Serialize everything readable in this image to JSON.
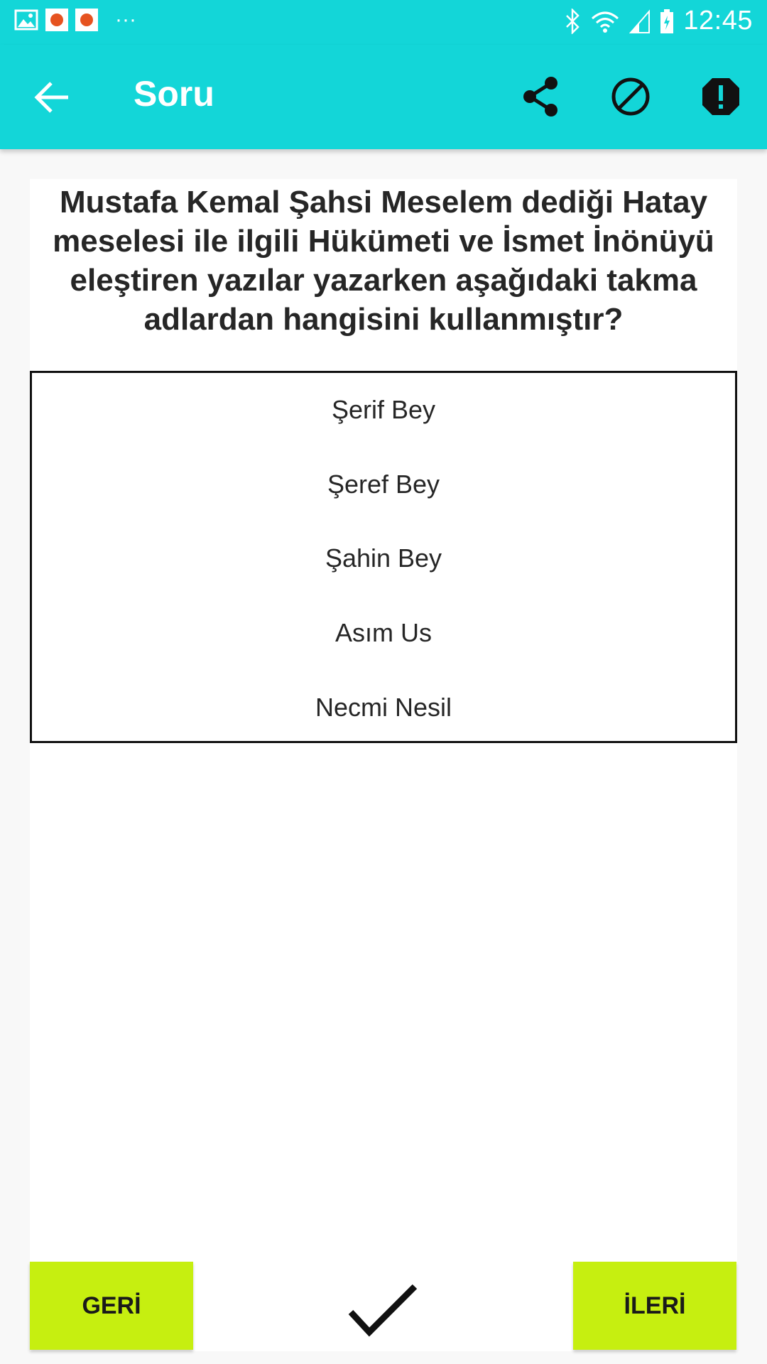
{
  "status_bar": {
    "time": "12:45",
    "left_icons": [
      "image-icon",
      "app-notification-icon",
      "app-notification-icon",
      "more-dots-icon"
    ],
    "right_icons": [
      "bluetooth-icon",
      "wifi-icon",
      "signal-icon",
      "battery-icon"
    ],
    "more_dots": "···"
  },
  "app_bar": {
    "title": "Soru",
    "actions": [
      "share-icon",
      "block-icon",
      "report-icon"
    ],
    "background": "#13d6d8"
  },
  "question": {
    "text": "Mustafa Kemal Şahsi Meselem dediği Hatay meselesi ile ilgili Hükümeti ve İsmet İnönüyü eleştiren yazılar yazarken aşağıdaki takma adlardan hangisini kullanmıştır?"
  },
  "options": [
    {
      "label": "Şerif Bey"
    },
    {
      "label": "Şeref Bey"
    },
    {
      "label": "Şahin Bey"
    },
    {
      "label": "Asım Us"
    },
    {
      "label": "Necmi Nesil"
    }
  ],
  "bottom_bar": {
    "back_label": "GERİ",
    "next_label": "İLERİ",
    "confirm_icon": "checkmark-icon",
    "button_color": "#c6ef10"
  }
}
